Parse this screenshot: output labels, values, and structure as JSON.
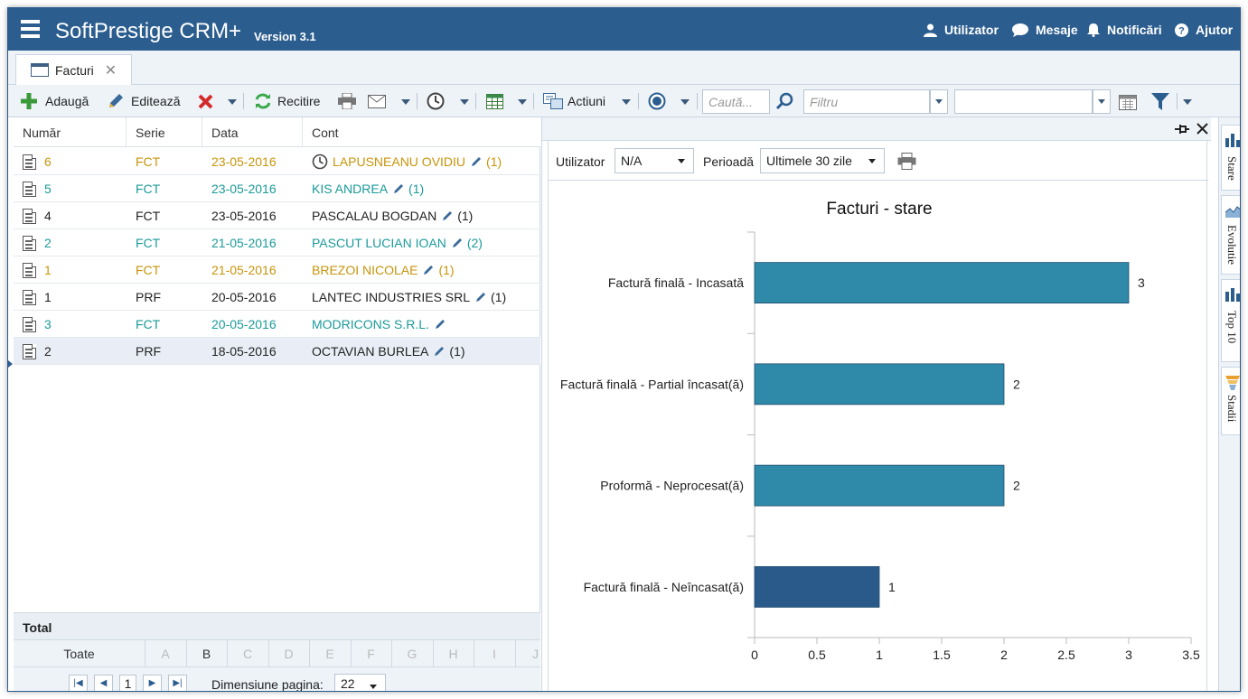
{
  "app": {
    "title": "SoftPrestige CRM+",
    "version": "Version 3.1",
    "accent": "#2b5d8f"
  },
  "header_links": [
    {
      "label": "Utilizator",
      "icon": "user-icon"
    },
    {
      "label": "Mesaje",
      "icon": "chat-icon"
    },
    {
      "label": "Notificări",
      "icon": "bell-icon"
    },
    {
      "label": "Ajutor",
      "icon": "help-icon"
    }
  ],
  "tab": {
    "label": "Facturi"
  },
  "toolbar": {
    "add_label": "Adaugă",
    "edit_label": "Editează",
    "reload_label": "Recitire",
    "actions_label": "Actiuni",
    "search_placeholder": "Caută...",
    "filter_placeholder": "Filtru"
  },
  "grid": {
    "columns": [
      "Număr",
      "Serie",
      "Data",
      "Cont"
    ],
    "rows": [
      {
        "numar": "6",
        "serie": "FCT",
        "data": "23-05-2016",
        "cont": "LAPUSNEANU OVIDIU",
        "count": "(1)",
        "color": "#c8940a",
        "clock": true
      },
      {
        "numar": "5",
        "serie": "FCT",
        "data": "23-05-2016",
        "cont": "KIS ANDREA",
        "count": "(1)",
        "color": "#1a9a9a",
        "clock": false
      },
      {
        "numar": "4",
        "serie": "FCT",
        "data": "23-05-2016",
        "cont": "PASCALAU BOGDAN",
        "count": "(1)",
        "color": "#222222",
        "clock": false
      },
      {
        "numar": "2",
        "serie": "FCT",
        "data": "21-05-2016",
        "cont": "PASCUT LUCIAN IOAN",
        "count": "(2)",
        "color": "#1a9a9a",
        "clock": false
      },
      {
        "numar": "1",
        "serie": "FCT",
        "data": "21-05-2016",
        "cont": "BREZOI NICOLAE",
        "count": "(1)",
        "color": "#c8940a",
        "clock": false
      },
      {
        "numar": "1",
        "serie": "PRF",
        "data": "20-05-2016",
        "cont": "LANTEC INDUSTRIES SRL",
        "count": "(1)",
        "color": "#222222",
        "clock": false
      },
      {
        "numar": "3",
        "serie": "FCT",
        "data": "20-05-2016",
        "cont": "MODRICONS S.R.L.",
        "count": "",
        "color": "#1a9a9a",
        "clock": false
      },
      {
        "numar": "2",
        "serie": "PRF",
        "data": "18-05-2016",
        "cont": "OCTAVIAN BURLEA",
        "count": "(1)",
        "color": "#222222",
        "clock": false,
        "selected": true
      }
    ],
    "total_label": "Total",
    "alpha_all": "Toate",
    "alpha_letters": [
      "A",
      "B",
      "C",
      "D",
      "E",
      "F",
      "G",
      "H",
      "I",
      "J"
    ],
    "alpha_active": "B",
    "current_page": "1",
    "page_size_label": "Dimensiune pagina:",
    "page_size": "22"
  },
  "panel": {
    "user_label": "Utilizator",
    "user_value": "N/A",
    "period_label": "Perioadă",
    "period_value": "Ultimele 30 zile"
  },
  "side_tabs": [
    "Stare",
    "Evolutie",
    "Top 10",
    "Stadii"
  ],
  "chart_data": {
    "type": "bar",
    "orientation": "horizontal",
    "title": "Facturi - stare",
    "categories": [
      "Factură finală - Incasată",
      "Factură finală - Partial încasat(ă)",
      "Proformă - Neprocesat(ă)",
      "Factură finală - Neîncasat(ă)"
    ],
    "values": [
      3,
      2,
      2,
      1
    ],
    "colors": [
      "#2e8aa8",
      "#2e8aa8",
      "#2e8aa8",
      "#2a5a8a"
    ],
    "xlim": [
      0,
      3.5
    ],
    "xticks": [
      0,
      0.5,
      1,
      1.5,
      2,
      2.5,
      3,
      3.5
    ],
    "tick_labels": [
      "0",
      "0.5",
      "1",
      "1.5",
      "2",
      "2.5",
      "3",
      "3.5"
    ],
    "value_labels": [
      "3",
      "2",
      "2",
      "1"
    ],
    "grid": false,
    "legend": "none"
  }
}
